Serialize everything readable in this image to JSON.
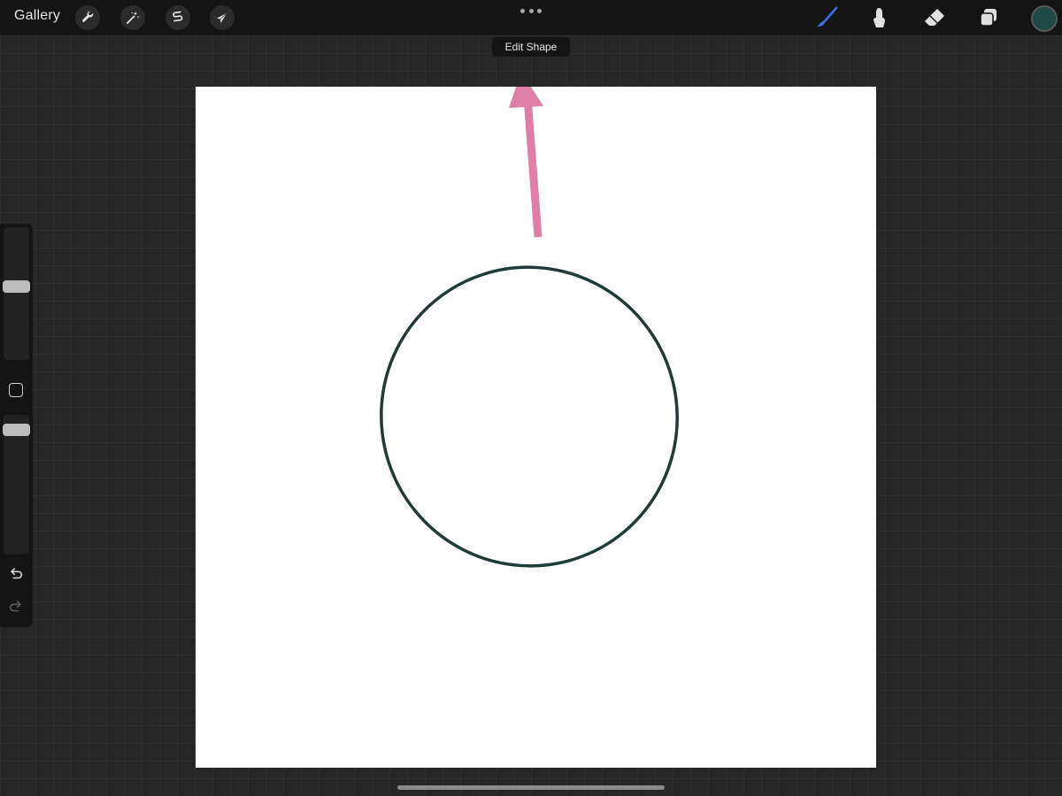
{
  "topbar": {
    "gallery_label": "Gallery",
    "left_tools": [
      {
        "name": "actions",
        "icon": "wrench-icon"
      },
      {
        "name": "adjustments",
        "icon": "magic-wand-icon"
      },
      {
        "name": "selection",
        "icon": "selection-s-icon"
      },
      {
        "name": "transform",
        "icon": "arrow-cursor-icon"
      }
    ],
    "more_icon": "ellipsis-icon",
    "right_tools": [
      {
        "name": "brush",
        "icon": "brush-icon",
        "active": true,
        "color": "#3a6fe0"
      },
      {
        "name": "smudge",
        "icon": "smudge-icon",
        "active": false,
        "color": "#e0e0e0"
      },
      {
        "name": "eraser",
        "icon": "eraser-icon",
        "active": false,
        "color": "#e0e0e0"
      },
      {
        "name": "layers",
        "icon": "layers-icon",
        "active": false,
        "color": "#e0e0e0"
      }
    ],
    "current_color": "#1d4a44"
  },
  "edit_shape": {
    "label": "Edit Shape"
  },
  "canvas": {
    "background": "#ffffff",
    "shape": "ellipse",
    "stroke_color": "#1f3a37",
    "annotation_arrow_color": "#e07fa5"
  },
  "sidebar": {
    "brush_size_level": 0.45,
    "opacity_level": 0.1,
    "modify_icon": "square-modify-icon",
    "undo_icon": "undo-icon",
    "redo_icon": "redo-icon"
  }
}
